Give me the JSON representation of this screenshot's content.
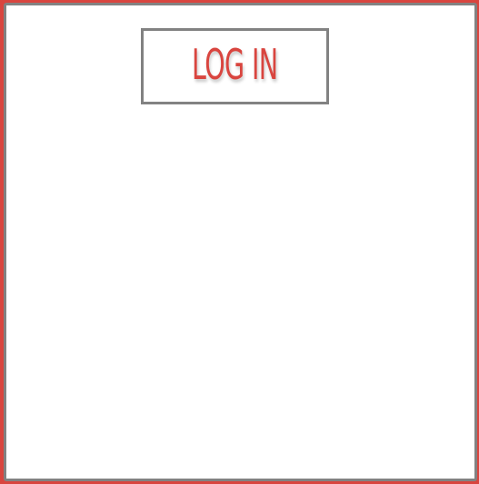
{
  "login": {
    "label": "LOG IN"
  },
  "colors": {
    "accent": "#d9453f",
    "border": "#828282",
    "panel": "#ffffff"
  }
}
